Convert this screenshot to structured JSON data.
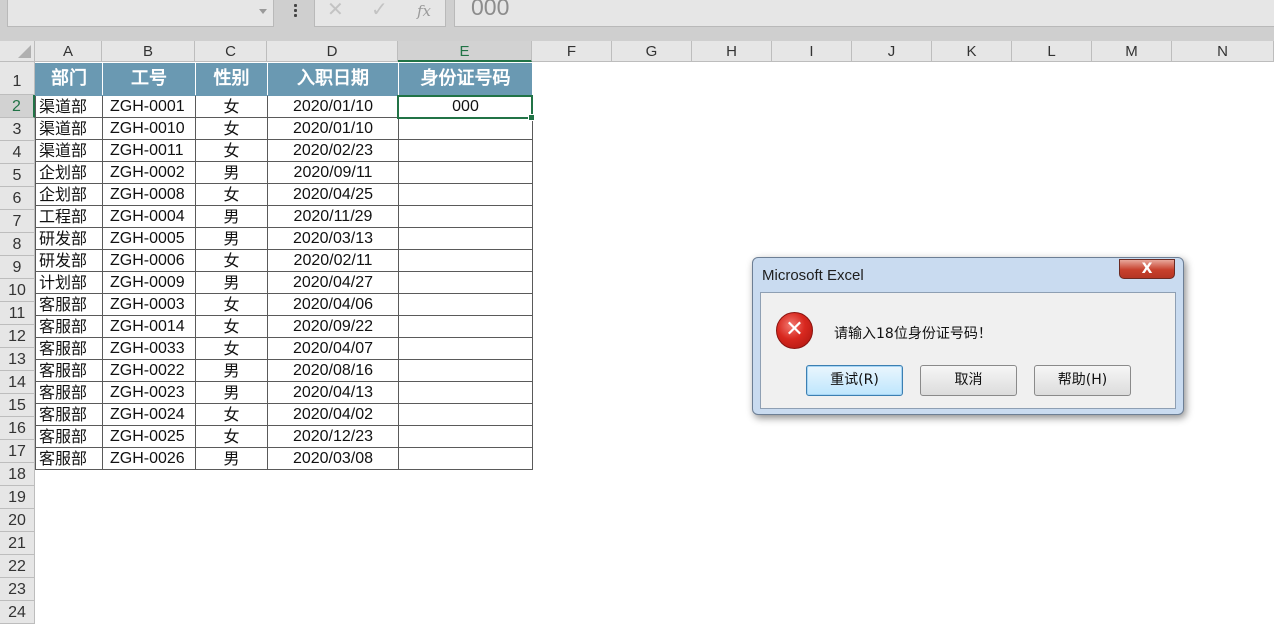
{
  "formula_bar": {
    "name_box": "",
    "cancel_icon": "✕",
    "enter_icon": "✓",
    "fx_label": "fx",
    "formula": "000"
  },
  "columns": [
    "A",
    "B",
    "C",
    "D",
    "E",
    "F",
    "G",
    "H",
    "I",
    "J",
    "K",
    "L",
    "M",
    "N"
  ],
  "selected_column": "E",
  "rows": [
    "1",
    "2",
    "3",
    "4",
    "5",
    "6",
    "7",
    "8",
    "9",
    "10",
    "11",
    "12",
    "13",
    "14",
    "15",
    "16",
    "17",
    "18",
    "19",
    "20",
    "21",
    "22",
    "23",
    "24"
  ],
  "selected_row": "2",
  "table": {
    "headers": [
      "部门",
      "工号",
      "性别",
      "入职日期",
      "身份证号码"
    ],
    "records": [
      [
        "渠道部",
        "ZGH-0001",
        "女",
        "2020/01/10",
        "000"
      ],
      [
        "渠道部",
        "ZGH-0010",
        "女",
        "2020/01/10",
        ""
      ],
      [
        "渠道部",
        "ZGH-0011",
        "女",
        "2020/02/23",
        ""
      ],
      [
        "企划部",
        "ZGH-0002",
        "男",
        "2020/09/11",
        ""
      ],
      [
        "企划部",
        "ZGH-0008",
        "女",
        "2020/04/25",
        ""
      ],
      [
        "工程部",
        "ZGH-0004",
        "男",
        "2020/11/29",
        ""
      ],
      [
        "研发部",
        "ZGH-0005",
        "男",
        "2020/03/13",
        ""
      ],
      [
        "研发部",
        "ZGH-0006",
        "女",
        "2020/02/11",
        ""
      ],
      [
        "计划部",
        "ZGH-0009",
        "男",
        "2020/04/27",
        ""
      ],
      [
        "客服部",
        "ZGH-0003",
        "女",
        "2020/04/06",
        ""
      ],
      [
        "客服部",
        "ZGH-0014",
        "女",
        "2020/09/22",
        ""
      ],
      [
        "客服部",
        "ZGH-0033",
        "女",
        "2020/04/07",
        ""
      ],
      [
        "客服部",
        "ZGH-0022",
        "男",
        "2020/08/16",
        ""
      ],
      [
        "客服部",
        "ZGH-0023",
        "男",
        "2020/04/13",
        ""
      ],
      [
        "客服部",
        "ZGH-0024",
        "女",
        "2020/04/02",
        ""
      ],
      [
        "客服部",
        "ZGH-0025",
        "女",
        "2020/12/23",
        ""
      ],
      [
        "客服部",
        "ZGH-0026",
        "男",
        "2020/03/08",
        ""
      ]
    ]
  },
  "dialog": {
    "title": "Microsoft Excel",
    "close_glyph": "X",
    "icon": "error-icon",
    "icon_glyph": "✕",
    "message": "请输入18位身份证号码！",
    "buttons": [
      "重试(R)",
      "取消",
      "帮助(H)"
    ]
  },
  "colors": {
    "header_fill": "#6a99b2",
    "selection": "#217346",
    "dialog_frame": "#c9dbf0",
    "error_red": "#d8281f"
  }
}
